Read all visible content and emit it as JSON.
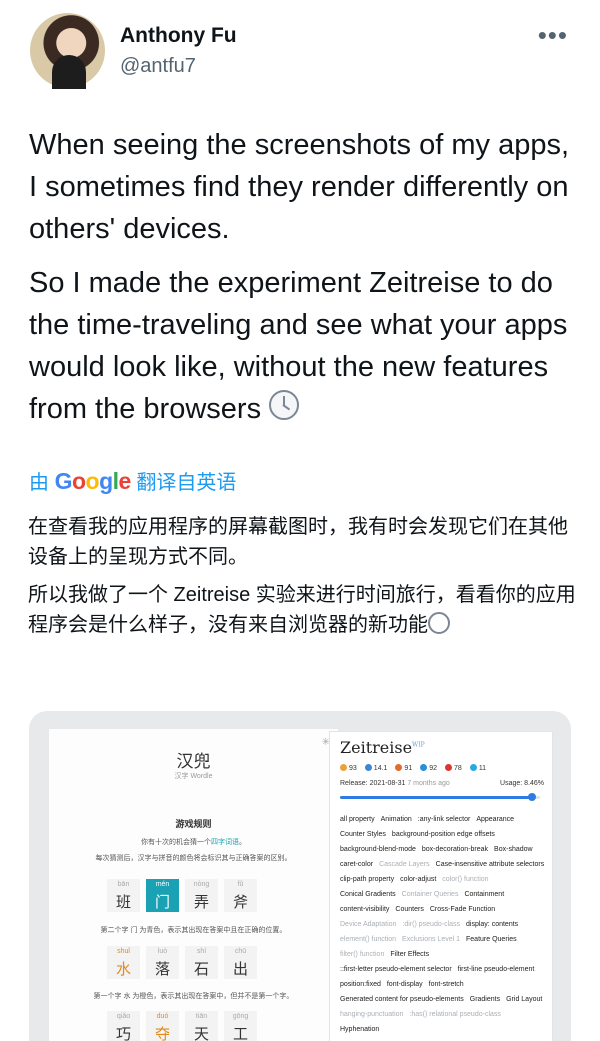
{
  "author": {
    "name": "Anthony Fu",
    "handle": "@antfu7"
  },
  "more_icon": "more-horizontal-icon",
  "tweet": {
    "paragraph1": "When seeing the screenshots of my apps, I sometimes find they render differently on others' devices.",
    "paragraph2": "So I made the experiment Zeitreise to do the time-traveling and see what your apps would look like, without the new features from the browsers",
    "emoji": "clock-icon"
  },
  "translation": {
    "prefix": "由",
    "google_letters": [
      "G",
      "o",
      "o",
      "g",
      "l",
      "e"
    ],
    "suffix": "翻译自英语",
    "paragraph1": "在查看我的应用程序的屏幕截图时，我有时会发现它们在其他设备上的呈现方式不同。",
    "paragraph2": "所以我做了一个 Zeitreise 实验来进行时间旅行，看看你的应用程序会是什么样子，没有来自浏览器的新功能"
  },
  "media": {
    "left": {
      "title": "汉兜",
      "subtitle": "汉字 Wordle",
      "rules_title": "游戏规则",
      "line1_prefix": "你有十次的机会猜一个",
      "line1_highlight": "四字词语",
      "line1_suffix": "。",
      "line2": "每次猜测后，汉字与拼音的颜色将会标识其与正确答案的区别。",
      "row1": [
        {
          "py": "bān",
          "hz": "班",
          "on": false
        },
        {
          "py": "mén",
          "hz": "门",
          "on": true
        },
        {
          "py": "nòng",
          "hz": "弄",
          "on": false
        },
        {
          "py": "fǔ",
          "hz": "斧",
          "on": false
        }
      ],
      "line3": "第二个字 门 为青色，表示其出现在答案中且在正确的位置。",
      "row2": [
        {
          "py": "shuǐ",
          "hz": "水",
          "or": true
        },
        {
          "py": "luò",
          "hz": "落",
          "or": false
        },
        {
          "py": "shí",
          "hz": "石",
          "or": false
        },
        {
          "py": "chū",
          "hz": "出",
          "or": false
        }
      ],
      "line4": "第一个字 水 为橙色，表示其出现在答案中，但并不是第一个字。",
      "row3": [
        {
          "py": "qiǎo",
          "hz": "巧"
        },
        {
          "py": "duó",
          "hz": "夺",
          "or": true
        },
        {
          "py": "tiān",
          "hz": "天"
        },
        {
          "py": "gōng",
          "hz": "工"
        }
      ]
    },
    "right": {
      "title": "Zeitreise",
      "badge": "WIP",
      "browsers": [
        {
          "v": "93",
          "color": "#e8a23a"
        },
        {
          "v": "14.1",
          "color": "#3a86d8"
        },
        {
          "v": "91",
          "color": "#e66a2b"
        },
        {
          "v": "92",
          "color": "#2b8fd8"
        },
        {
          "v": "78",
          "color": "#e0352b"
        },
        {
          "v": "11",
          "color": "#2aa6e3"
        }
      ],
      "release_label": "Release: 2021-08-31",
      "release_ago": "7 months ago",
      "usage": "Usage: 8.46%",
      "slider_level": 0.96,
      "features": [
        {
          "t": "all property"
        },
        {
          "t": "Animation"
        },
        {
          "t": ":any-link selector"
        },
        {
          "t": "Appearance"
        },
        {
          "t": "Counter Styles"
        },
        {
          "t": "background-position edge offsets"
        },
        {
          "t": "background-blend-mode"
        },
        {
          "t": "box-decoration-break"
        },
        {
          "t": "Box-shadow"
        },
        {
          "t": "caret-color"
        },
        {
          "t": "Cascade Layers",
          "dis": true
        },
        {
          "t": "Case-insensitive attribute selectors"
        },
        {
          "t": "clip-path property"
        },
        {
          "t": "color-adjust"
        },
        {
          "t": "color() function",
          "dis": true
        },
        {
          "t": "Conical Gradients"
        },
        {
          "t": "Container Queries",
          "dis": true
        },
        {
          "t": "Containment"
        },
        {
          "t": "content-visibility"
        },
        {
          "t": "Counters"
        },
        {
          "t": "Cross-Fade Function"
        },
        {
          "t": "Device Adaptation",
          "dis": true
        },
        {
          "t": ":dir() pseudo-class",
          "dis": true
        },
        {
          "t": "display: contents"
        },
        {
          "t": "element() function",
          "dis": true
        },
        {
          "t": "Exclusions Level 1",
          "dis": true
        },
        {
          "t": "Feature Queries"
        },
        {
          "t": "filter() function",
          "dis": true
        },
        {
          "t": "Filter Effects"
        },
        {
          "t": "::first-letter pseudo-element selector"
        },
        {
          "t": "first-line pseudo-element"
        },
        {
          "t": "position:fixed"
        },
        {
          "t": "font-display"
        },
        {
          "t": "font-stretch"
        },
        {
          "t": "Generated content for pseudo-elements"
        },
        {
          "t": "Gradients"
        },
        {
          "t": "Grid Layout"
        },
        {
          "t": "hanging-punctuation",
          "dis": true
        },
        {
          "t": ":has() relational pseudo-class",
          "dis": true
        },
        {
          "t": "Hyphenation"
        }
      ]
    }
  }
}
